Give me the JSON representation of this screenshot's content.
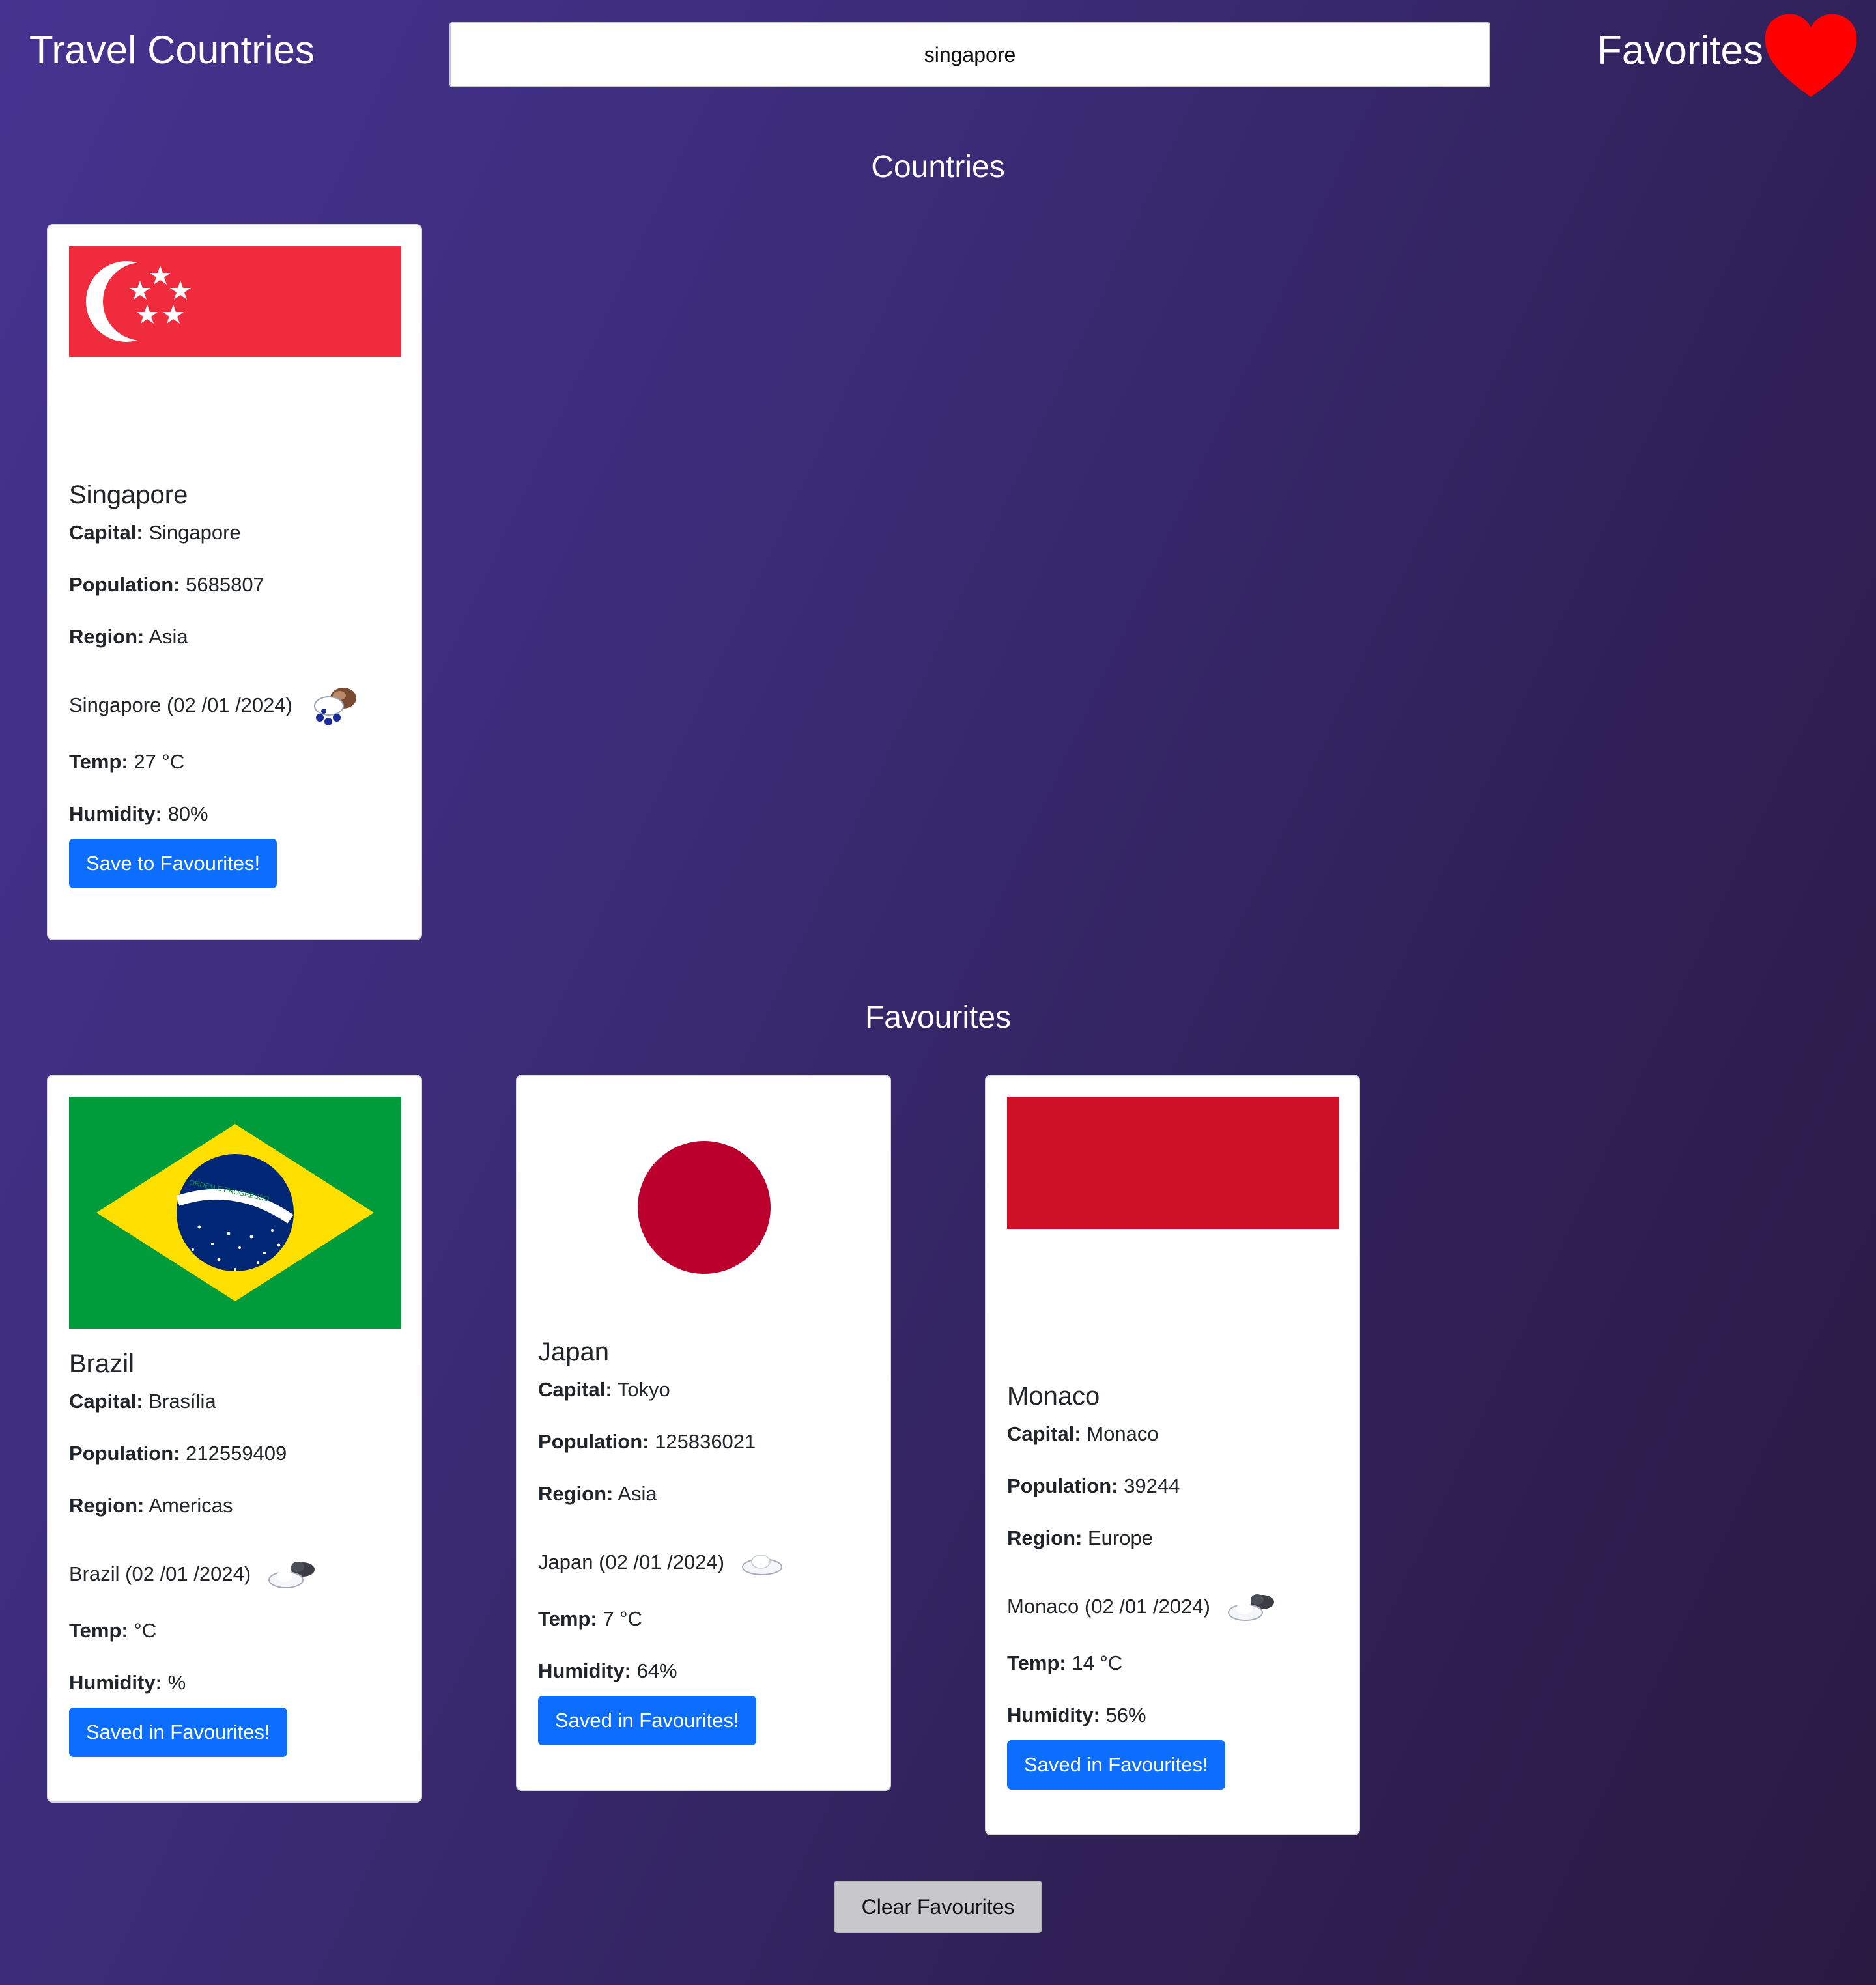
{
  "header": {
    "title": "Travel Countries",
    "search_value": "singapore",
    "favorites_label": "Favorites",
    "heart_icon": "heart-icon",
    "heart_color": "#ff0000"
  },
  "sections": {
    "countries_title": "Countries",
    "favourites_title": "Favourites"
  },
  "labels": {
    "capital": "Capital:",
    "population": "Population:",
    "region": "Region:",
    "temp": "Temp:",
    "humidity": "Humidity:"
  },
  "countries": [
    {
      "name": "Singapore",
      "flag_icon": "singapore-flag",
      "capital": "Singapore",
      "population": "5685807",
      "region": "Asia",
      "weather_place_date": "Singapore (02 /01 /2024)",
      "weather_icon": "rain-cloud-icon",
      "temp": "27 °C",
      "humidity": "80%",
      "button": "Save to Favourites!"
    }
  ],
  "favourites": [
    {
      "name": "Brazil",
      "flag_icon": "brazil-flag",
      "flag_motto": "ORDEM E PROGRESSO",
      "capital": "Brasília",
      "population": "212559409",
      "region": "Americas",
      "weather_place_date": "Brazil (02 /01 /2024)",
      "weather_icon": "cloudy-icon",
      "temp": "°C",
      "humidity": "%",
      "button": "Saved in Favourites!"
    },
    {
      "name": "Japan",
      "flag_icon": "japan-flag",
      "capital": "Tokyo",
      "population": "125836021",
      "region": "Asia",
      "weather_place_date": "Japan (02 /01 /2024)",
      "weather_icon": "cloud-icon",
      "temp": "7 °C",
      "humidity": "64%",
      "button": "Saved in Favourites!"
    },
    {
      "name": "Monaco",
      "flag_icon": "monaco-flag",
      "capital": "Monaco",
      "population": "39244",
      "region": "Europe",
      "weather_place_date": "Monaco (02 /01 /2024)",
      "weather_icon": "cloudy-icon",
      "temp": "14 °C",
      "humidity": "56%",
      "button": "Saved in Favourites!"
    }
  ],
  "clear_button": "Clear Favourites",
  "colors": {
    "primary_button": "#0d6efd",
    "background_start": "#45338f",
    "background_end": "#2a1a42",
    "singapore_red": "#ef2b3d",
    "brazil_green": "#009b3a",
    "brazil_yellow": "#fedf00",
    "brazil_blue": "#002776",
    "japan_red": "#bc002d",
    "monaco_red": "#ce1126"
  }
}
